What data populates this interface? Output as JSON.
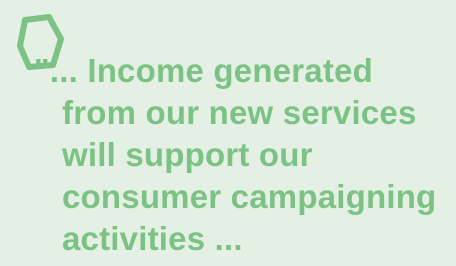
{
  "quote": {
    "lines": [
      "\"... Income generated",
      "from our new services",
      "will support our",
      "consumer campaigning",
      "activities ..."
    ]
  },
  "colors": {
    "background": "#e3f0e3",
    "accent": "#7cc285"
  },
  "icons": {
    "badge": "speech-bubble-outline-icon"
  }
}
